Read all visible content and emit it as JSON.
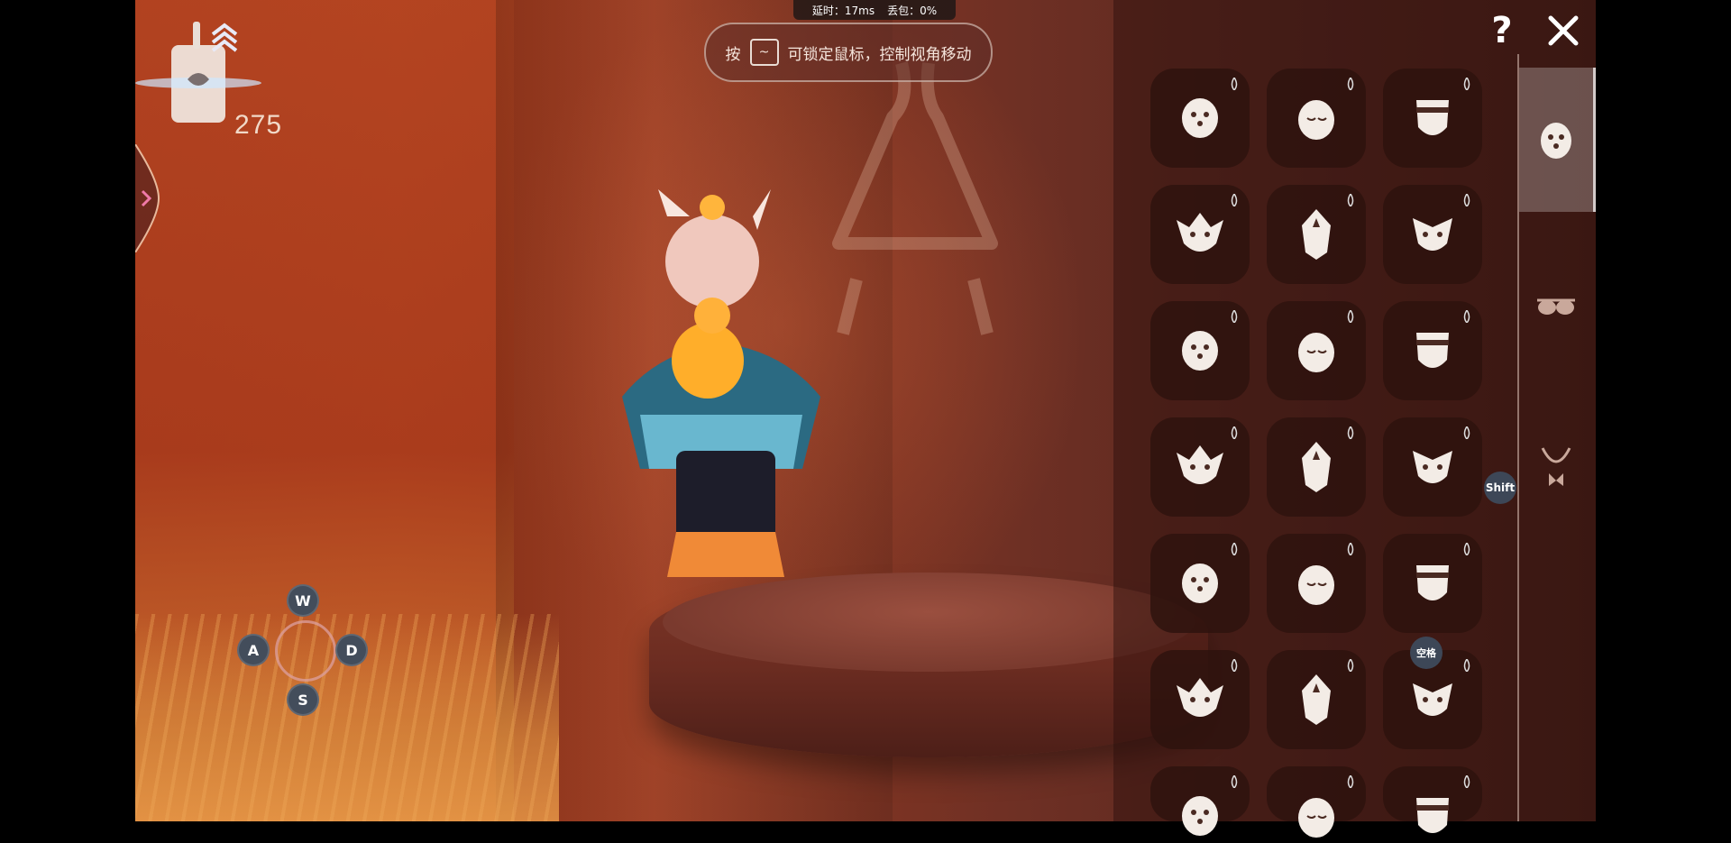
{
  "hud": {
    "candle_count": "275",
    "ping": {
      "latency": "延时：17ms",
      "loss": "丢包：0%"
    },
    "lock_hint": {
      "prefix": "按",
      "key": "~",
      "suffix": "可锁定鼠标，控制视角移动"
    }
  },
  "controls": {
    "w": "W",
    "a": "A",
    "s": "S",
    "d": "D",
    "shift_hint": "Shift",
    "space_hint": "空格"
  },
  "panel": {
    "help": "?",
    "grid_rows": 7,
    "grid_cols": 3,
    "categories": [
      {
        "name": "mask-category",
        "icon": "mask-icon",
        "active": true
      },
      {
        "name": "glasses-category",
        "icon": "glasses-icon",
        "active": false
      },
      {
        "name": "necklace-category",
        "icon": "necklace-icon",
        "active": false
      }
    ]
  },
  "colors": {
    "accent_white": "#f3ece6",
    "cell_bg": "#2d120e",
    "key_bg": "#434d5b"
  }
}
